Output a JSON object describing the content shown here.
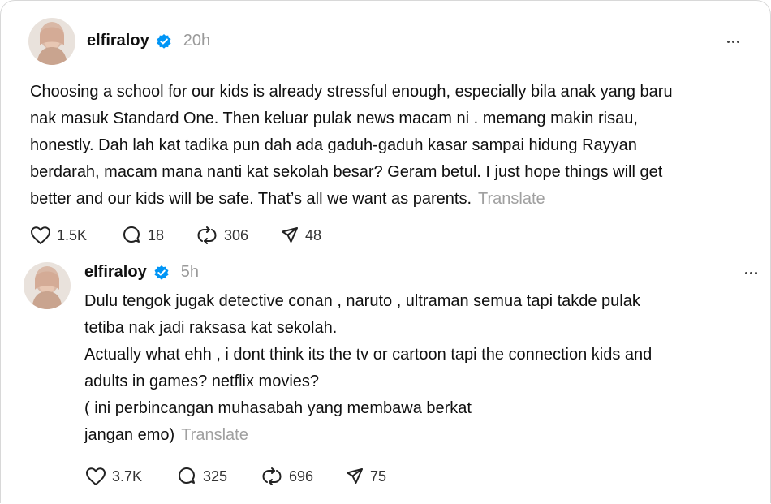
{
  "posts": [
    {
      "username": "elfiraloy",
      "time": "20h",
      "lines": [
        "Choosing a school for our kids is already stressful enough, especially bila anak yang baru",
        "nak masuk Standard One. Then keluar pulak news macam ni . memang makin risau,",
        "honestly. Dah lah kat tadika pun dah ada gaduh-gaduh kasar sampai hidung Rayyan",
        "berdarah, macam mana nanti kat sekolah besar? Geram betul. I just hope things will get",
        "better and our kids will be safe. That’s all we want as parents."
      ],
      "translate": "Translate",
      "likes": "1.5K",
      "replies": "18",
      "reposts": "306",
      "shares": "48"
    },
    {
      "username": "elfiraloy",
      "time": "5h",
      "lines": [
        "Dulu tengok jugak detective conan , naruto , ultraman semua tapi takde pulak",
        "tetiba nak jadi raksasa kat sekolah.",
        "Actually what ehh , i dont think its the tv or cartoon tapi the connection kids and",
        "adults in games? netflix movies?",
        "( ini perbincangan muhasabah yang membawa berkat",
        "jangan emo)"
      ],
      "translate": "Translate",
      "likes": "3.7K",
      "replies": "325",
      "reposts": "696",
      "shares": "75"
    }
  ],
  "icons": {
    "verified": "verified-badge-icon",
    "more": "more-options-icon",
    "like": "heart-icon",
    "reply": "comment-icon",
    "repost": "repost-icon",
    "share": "share-icon"
  },
  "colors": {
    "verified": "#0095f6",
    "muted": "#9a9a9a",
    "text": "#101010"
  }
}
